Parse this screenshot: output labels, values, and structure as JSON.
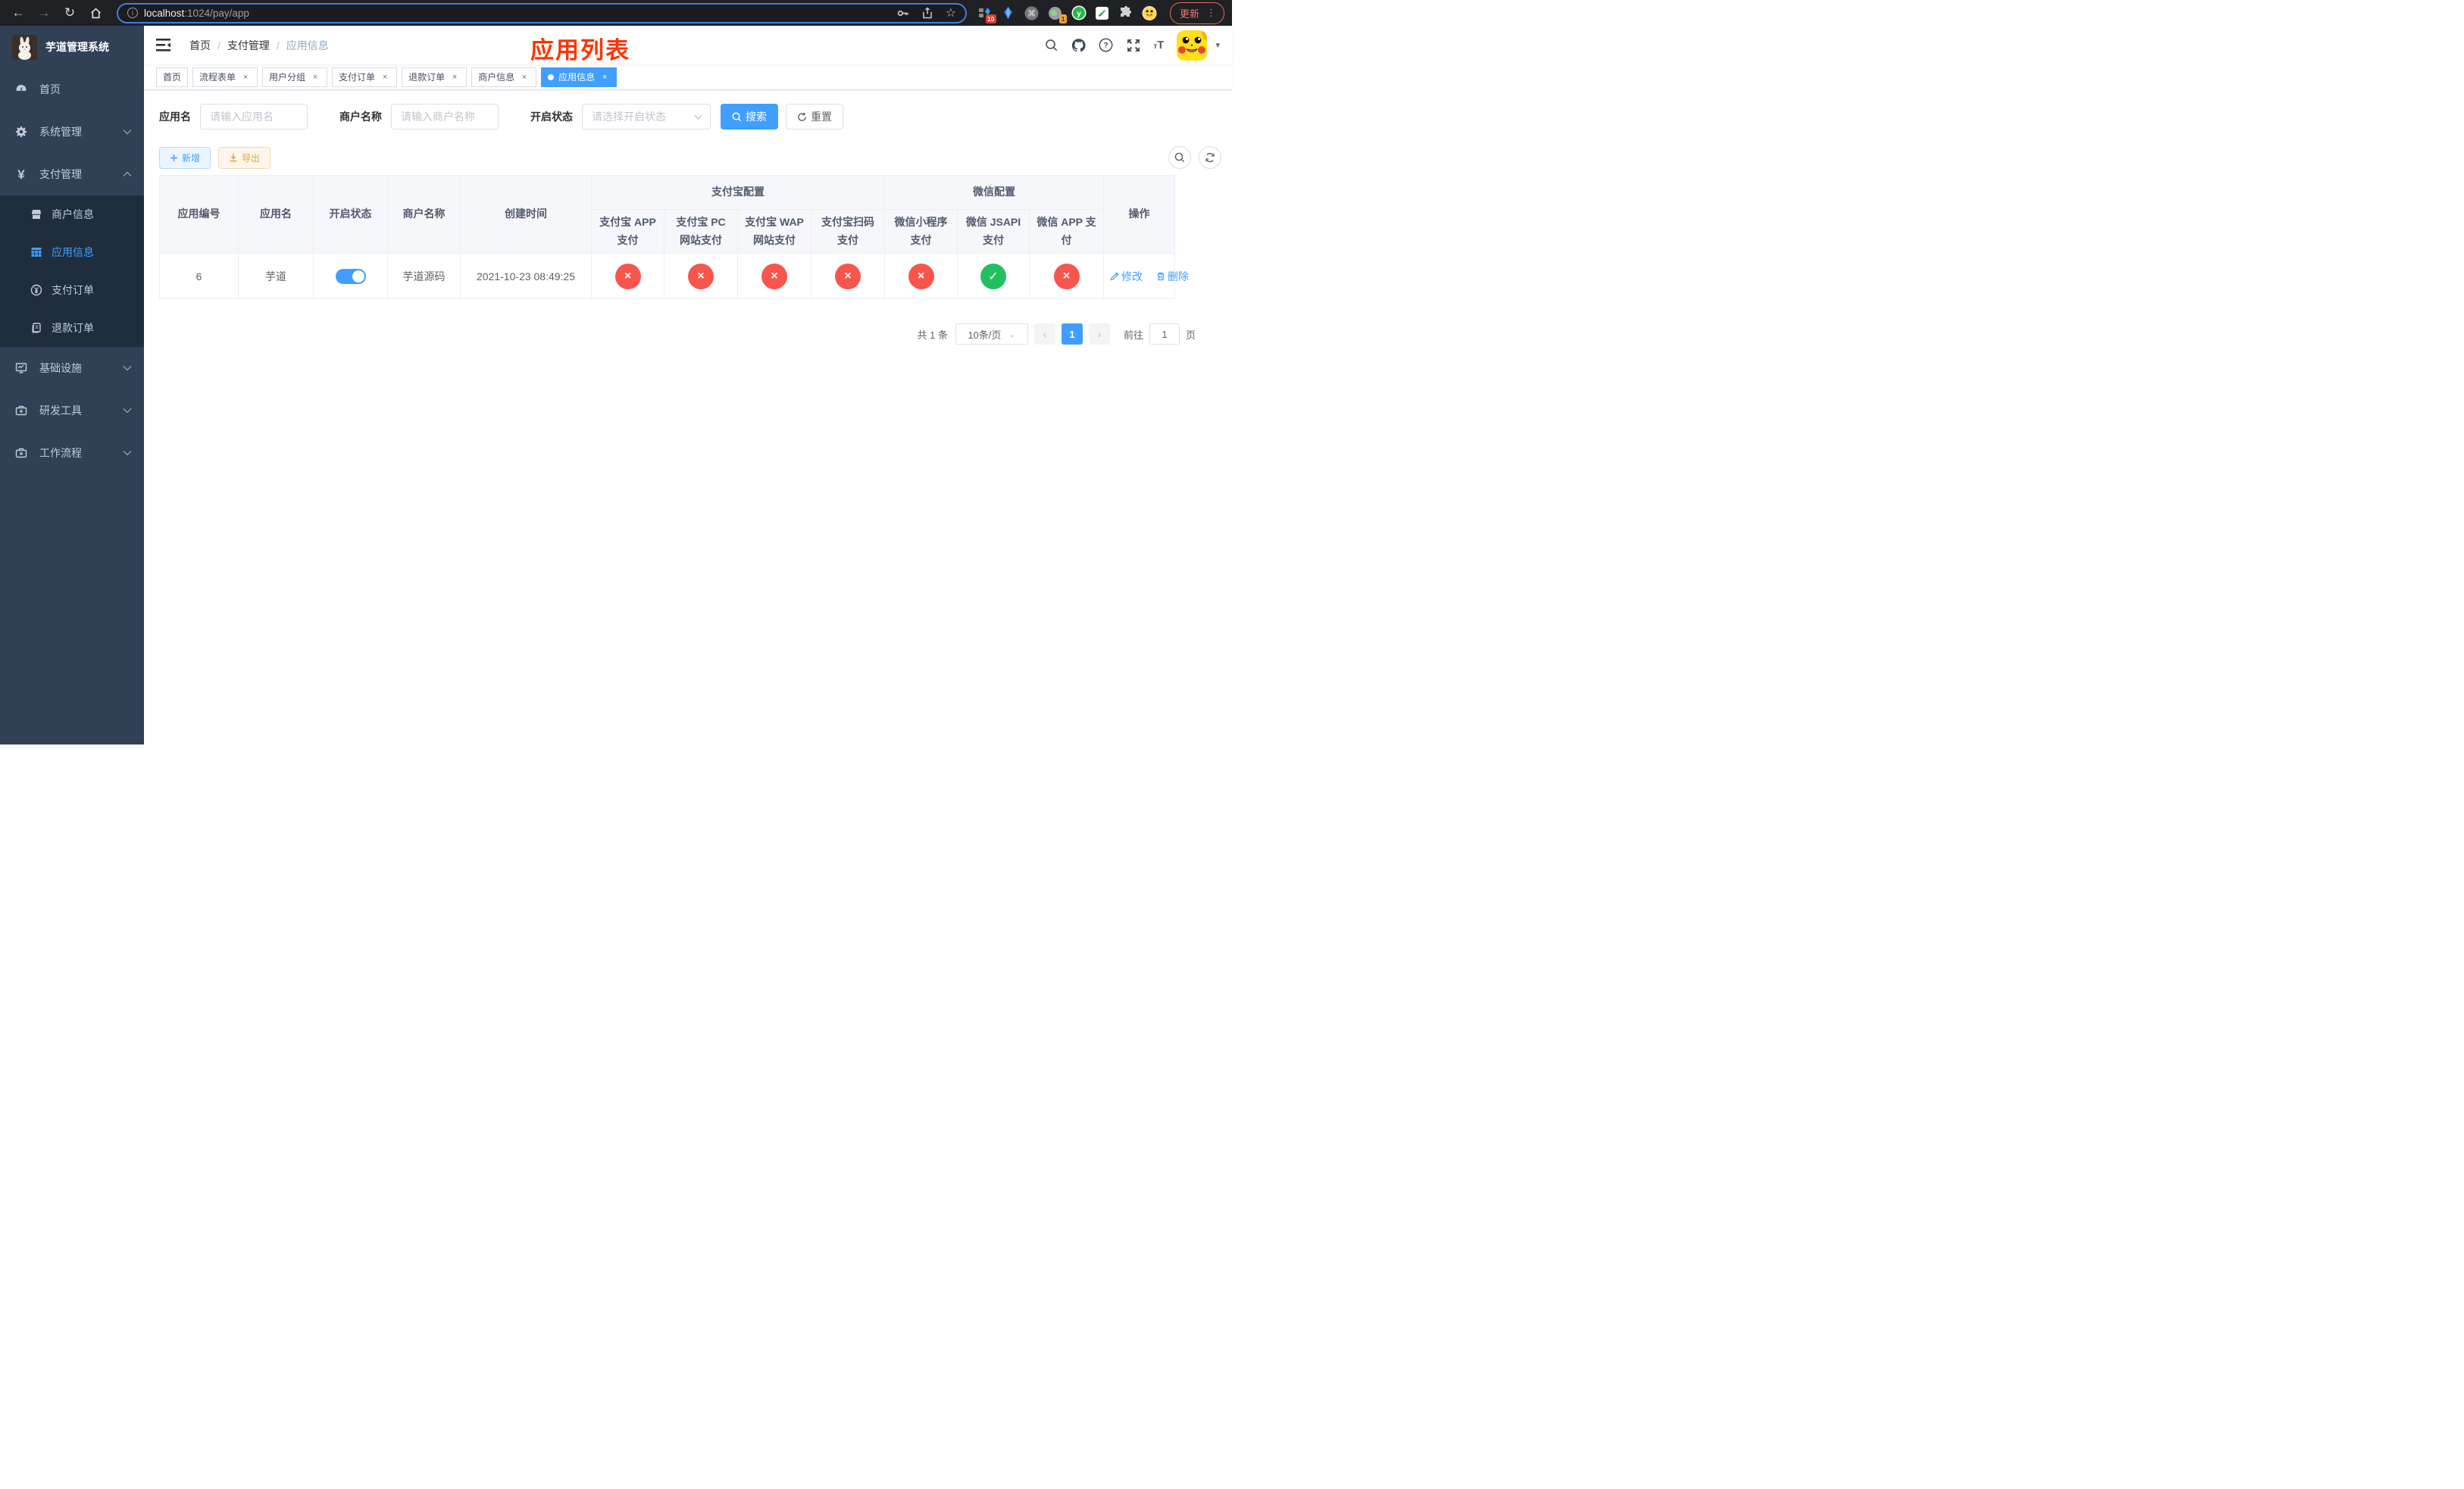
{
  "browser": {
    "url_host": "localhost",
    "url_rest": ":1024/pay/app",
    "update_label": "更新",
    "ext_badge_blocks": "10",
    "ext_badge_session": "1",
    "ext_y_letter": "y"
  },
  "icons": {
    "back": "←",
    "forward": "→",
    "reload": "↻",
    "star": "☆",
    "info": "i",
    "dots": "⋮",
    "check": "✓",
    "cross": "×",
    "close": "×",
    "prev": "‹",
    "next": "›",
    "caret_down": "▾",
    "select_caret": "⌄",
    "font_small": "т",
    "font_big": "T",
    "question": "?"
  },
  "sidebar": {
    "title": "芋道管理系统",
    "items_top": [
      {
        "label": "首页",
        "icon": "dashboard",
        "caret": false
      },
      {
        "label": "系统管理",
        "icon": "gear",
        "caret": "down"
      },
      {
        "label": "支付管理",
        "icon": "yen",
        "caret": "up"
      }
    ],
    "submenu": [
      {
        "label": "商户信息",
        "icon": "shop",
        "active": false
      },
      {
        "label": "应用信息",
        "icon": "grid",
        "active": true
      },
      {
        "label": "支付订单",
        "icon": "coin",
        "active": false
      },
      {
        "label": "退款订单",
        "icon": "doc",
        "active": false
      }
    ],
    "items_bottom": [
      {
        "label": "基础设施",
        "icon": "monitor",
        "caret": "down"
      },
      {
        "label": "研发工具",
        "icon": "briefcase",
        "caret": "down"
      },
      {
        "label": "工作流程",
        "icon": "briefcase",
        "caret": "down"
      }
    ]
  },
  "breadcrumb": {
    "items": [
      "首页",
      "支付管理",
      "应用信息"
    ]
  },
  "page_title": "应用列表",
  "tabs": [
    {
      "label": "首页",
      "closable": false,
      "active": false
    },
    {
      "label": "流程表单",
      "closable": true,
      "active": false
    },
    {
      "label": "用户分组",
      "closable": true,
      "active": false
    },
    {
      "label": "支付订单",
      "closable": true,
      "active": false
    },
    {
      "label": "退款订单",
      "closable": true,
      "active": false
    },
    {
      "label": "商户信息",
      "closable": true,
      "active": false
    },
    {
      "label": "应用信息",
      "closable": true,
      "active": true
    }
  ],
  "search": {
    "app_name_label": "应用名",
    "app_name_placeholder": "请输入应用名",
    "merchant_label": "商户名称",
    "merchant_placeholder": "请输入商户名称",
    "status_label": "开启状态",
    "status_placeholder": "请选择开启状态",
    "search_button": "搜索",
    "reset_button": "重置"
  },
  "toolbar": {
    "add_button": "新增",
    "export_button": "导出"
  },
  "table": {
    "columns": [
      "应用编号",
      "应用名",
      "开启状态",
      "商户名称",
      "创建时间"
    ],
    "group_alipay": "支付宝配置",
    "group_wechat": "微信配置",
    "alipay_cols": [
      "支付宝 APP 支付",
      "支付宝 PC 网站支付",
      "支付宝 WAP 网站支付",
      "支付宝扫码支付"
    ],
    "wechat_cols": [
      "微信小程序支付",
      "微信 JSAPI 支付",
      "微信 APP 支付"
    ],
    "op_column": "操作",
    "row": {
      "id": "6",
      "name": "芋道",
      "enabled": true,
      "merchant": "芋道源码",
      "created": "2021-10-23 08:49:25",
      "alipay": [
        false,
        false,
        false,
        false
      ],
      "wechat": [
        false,
        true,
        false
      ],
      "edit_label": "修改",
      "delete_label": "删除"
    }
  },
  "pagination": {
    "total": "共 1 条",
    "page_size": "10条/页",
    "current_page": "1",
    "goto_label": "前往",
    "goto_value": "1",
    "page_suffix": "页"
  }
}
